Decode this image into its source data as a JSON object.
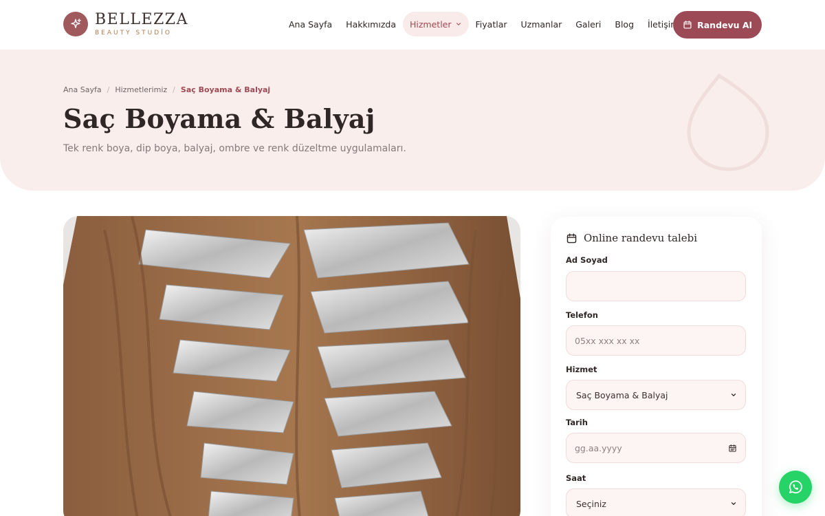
{
  "brand": {
    "name": "BELLEZZA",
    "tagline": "BEAUTY STUDİO",
    "accent": "#9c4a55"
  },
  "nav": {
    "items": [
      {
        "label": "Ana Sayfa"
      },
      {
        "label": "Hakkımızda"
      },
      {
        "label": "Hizmetler",
        "active": true,
        "icon": "chevron-down-icon"
      },
      {
        "label": "Fiyatlar"
      },
      {
        "label": "Uzmanlar"
      },
      {
        "label": "Galeri"
      },
      {
        "label": "Blog"
      },
      {
        "label": "İletişim"
      }
    ],
    "cta_label": "Randevu Al"
  },
  "breadcrumb": {
    "items": [
      "Ana Sayfa",
      "Hizmetlerimiz",
      "Saç Boyama & Balyaj"
    ],
    "separator": "/"
  },
  "page": {
    "title": "Saç Boyama & Balyaj",
    "description": "Tek renk boya, dip boya, balyaj, ombre ve renk düzeltme uygulamaları."
  },
  "form": {
    "title": "Online randevu talebi",
    "fields": {
      "name": {
        "label": "Ad Soyad",
        "value": "",
        "placeholder": ""
      },
      "phone": {
        "label": "Telefon",
        "value": "",
        "placeholder": "05xx xxx xx xx"
      },
      "service": {
        "label": "Hizmet",
        "value": "Saç Boyama & Balyaj"
      },
      "date": {
        "label": "Tarih",
        "placeholder": "gg.aa.yyyy"
      },
      "time": {
        "label": "Saat",
        "value": "Seçiniz"
      }
    }
  },
  "whatsapp": {
    "icon": "whatsapp-icon",
    "color": "#25d366"
  }
}
